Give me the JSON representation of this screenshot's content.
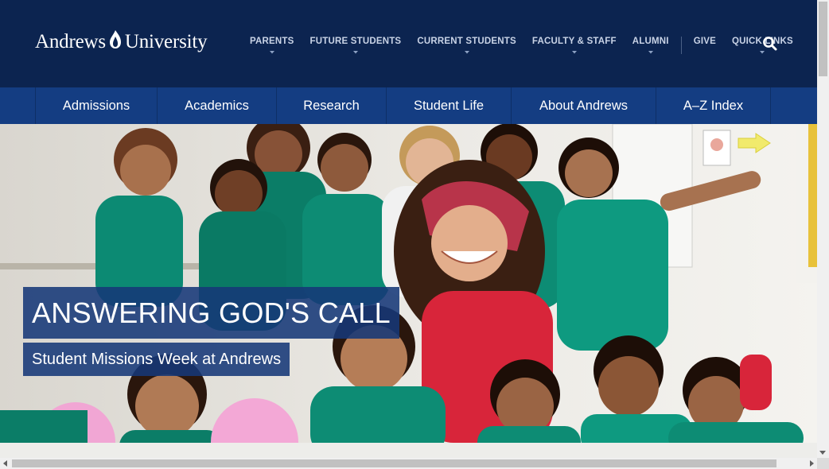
{
  "brand": {
    "name_left": "Andrews",
    "name_right": "University"
  },
  "utility_nav": {
    "items": [
      "PARENTS",
      "FUTURE STUDENTS",
      "CURRENT STUDENTS",
      "FACULTY & STAFF",
      "ALUMNI"
    ],
    "give": "GIVE",
    "quick_links": "QUICK LINKS",
    "search_icon": "search-icon"
  },
  "main_nav": {
    "items": [
      "Admissions",
      "Academics",
      "Research",
      "Student Life",
      "About Andrews",
      "A–Z Index"
    ]
  },
  "hero": {
    "title": "ANSWERING GOD'S CALL",
    "subtitle": "Student Missions Week at Andrews"
  },
  "colors": {
    "header_bg": "#0c2450",
    "nav_bg": "#143d82",
    "caption_bg": "#163878"
  }
}
